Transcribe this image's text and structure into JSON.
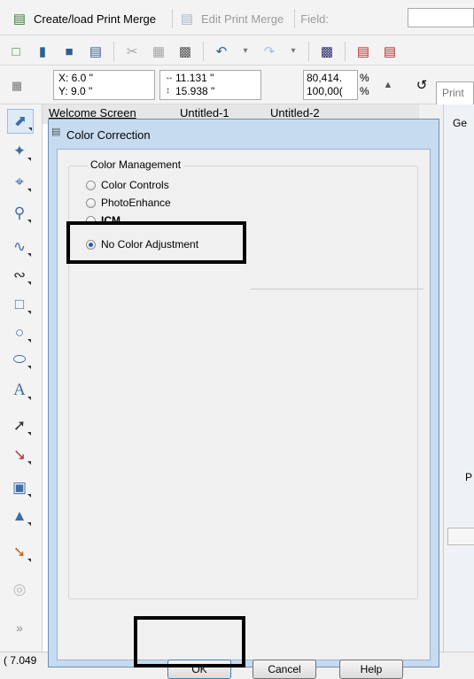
{
  "toolbar1": {
    "print_merge_label": "Create/load Print Merge",
    "edit_merge_label": "Edit Print Merge",
    "field_label": "Field:"
  },
  "toolbar3": {
    "x_value": "X: 6.0 \"",
    "y_value": "Y: 9.0 \"",
    "width_value": "11.131 \"",
    "height_value": "15.938 \"",
    "scale_x": "80,414.",
    "scale_y": "100,00(",
    "pct_1": "%",
    "pct_2": "%",
    "print_label": "Print"
  },
  "tabs": [
    "Welcome Screen",
    "Untitled-1",
    "Untitled-2"
  ],
  "right_panel_label": "Ge",
  "right_panel_letter": "P",
  "status_text": "( 7.049",
  "side_label": "Pages",
  "dialog": {
    "title": "Color Correction",
    "group_label": "Color Management",
    "options": [
      "Color Controls",
      "PhotoEnhance",
      "ICM",
      "No Color Adjustment"
    ],
    "selected": "No Color Adjustment",
    "buttons": {
      "ok": "OK",
      "cancel": "Cancel",
      "help": "Help"
    }
  },
  "icons": [
    "print-merge-icon",
    "edit-merge-icon",
    "new-icon",
    "open-icon",
    "save-icon",
    "print-icon",
    "cut-icon",
    "copy-icon",
    "paste-icon",
    "undo-icon",
    "redo-icon",
    "launcher-icon",
    "import-icon",
    "export-icon",
    "position-icon",
    "lock-icon",
    "rotate-icon",
    "pick-tool-icon",
    "shape-tool-icon",
    "crop-tool-icon",
    "zoom-tool-icon",
    "freehand-tool-icon",
    "artistic-media-icon",
    "rectangle-tool-icon",
    "ellipse-tool-icon",
    "polygon-tool-icon",
    "text-tool-icon",
    "dimension-tool-icon",
    "connector-tool-icon",
    "drop-shadow-icon",
    "transparency-icon",
    "eyedropper-icon",
    "fill-tool-icon",
    "outline-pen-icon",
    "expand-icon"
  ],
  "highlight_color": "#000000"
}
